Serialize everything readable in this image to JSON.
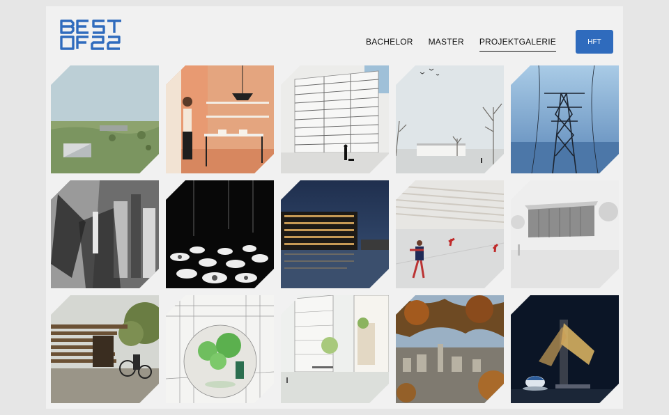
{
  "brand": {
    "logo_line1": "BEST",
    "logo_line2": "OF22",
    "logo_color": "#2f6bbd"
  },
  "nav": {
    "items": [
      {
        "label": "BACHELOR",
        "active": false
      },
      {
        "label": "MASTER",
        "active": false
      },
      {
        "label": "PROJEKTGALERIE",
        "active": true
      }
    ],
    "cta_label": "HFT",
    "cta_color": "#2f6bbd"
  },
  "gallery": {
    "tiles": [
      {
        "subject": "landscape-render"
      },
      {
        "subject": "kitchen-interior"
      },
      {
        "subject": "apartment-block-sketch"
      },
      {
        "subject": "winter-campus"
      },
      {
        "subject": "power-pylon"
      },
      {
        "subject": "monochrome-city-collage"
      },
      {
        "subject": "dark-installation"
      },
      {
        "subject": "night-waterfront-building"
      },
      {
        "subject": "sports-hall"
      },
      {
        "subject": "grey-pavilion"
      },
      {
        "subject": "timber-shelter"
      },
      {
        "subject": "tree-atrium-drawing"
      },
      {
        "subject": "courtyard-housing"
      },
      {
        "subject": "autumn-city-view"
      },
      {
        "subject": "night-lamp-object"
      }
    ]
  }
}
